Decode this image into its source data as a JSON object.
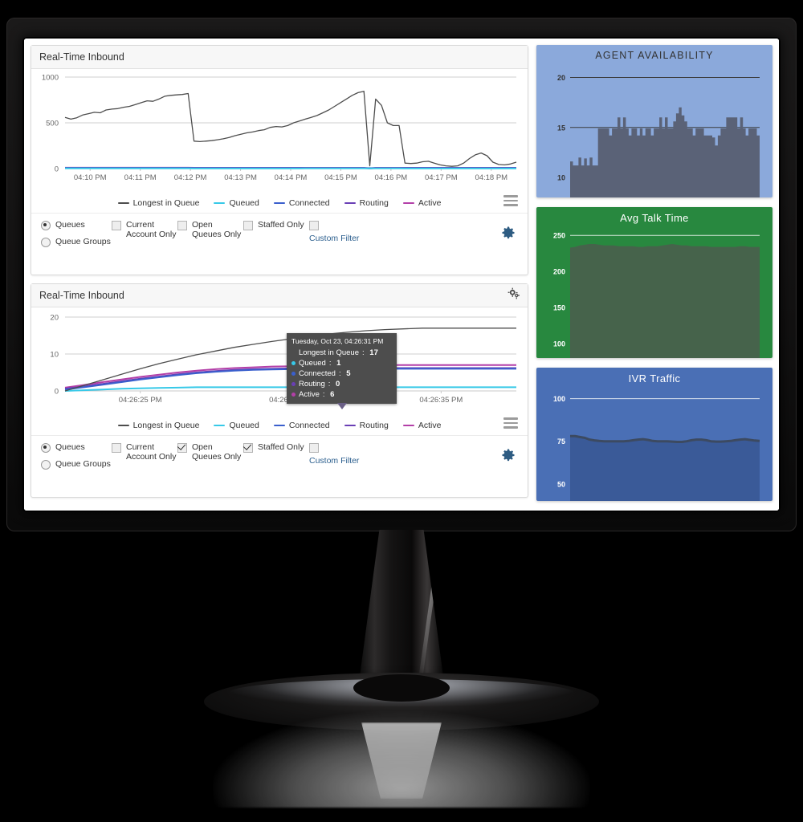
{
  "device": {
    "type": "desktop-monitor"
  },
  "panels": [
    {
      "title": "Real-Time Inbound",
      "header_icon": "hamburger-menu-icon",
      "legend": [
        {
          "label": "Longest in Queue",
          "color": "#4d4d4d"
        },
        {
          "label": "Queued",
          "color": "#37c9e8"
        },
        {
          "label": "Connected",
          "color": "#3a5fcd"
        },
        {
          "label": "Routing",
          "color": "#6a3fb5"
        },
        {
          "label": "Active",
          "color": "#b33fa8"
        }
      ],
      "controls": {
        "radios": [
          {
            "label": "Queues",
            "selected": true
          },
          {
            "label": "Queue Groups",
            "selected": false
          }
        ],
        "checkboxes": [
          {
            "label": "Current Account Only",
            "checked": false
          },
          {
            "label": "Open Queues Only",
            "checked": false
          },
          {
            "label": "Staffed Only",
            "checked": false
          }
        ],
        "custom_filter": {
          "label": "Custom Filter",
          "checked": false
        },
        "settings_icon": "gear-icon"
      }
    },
    {
      "title": "Real-Time Inbound",
      "header_icon": "settings-gears-icon",
      "legend": [
        {
          "label": "Longest in Queue",
          "color": "#4d4d4d"
        },
        {
          "label": "Queued",
          "color": "#37c9e8"
        },
        {
          "label": "Connected",
          "color": "#3a5fcd"
        },
        {
          "label": "Routing",
          "color": "#6a3fb5"
        },
        {
          "label": "Active",
          "color": "#b33fa8"
        }
      ],
      "controls": {
        "radios": [
          {
            "label": "Queues",
            "selected": true
          },
          {
            "label": "Queue Groups",
            "selected": false
          }
        ],
        "checkboxes": [
          {
            "label": "Current Account Only",
            "checked": false
          },
          {
            "label": "Open Queues Only",
            "checked": true
          },
          {
            "label": "Staffed Only",
            "checked": true
          }
        ],
        "custom_filter": {
          "label": "Custom Filter",
          "checked": false
        },
        "settings_icon": "gear-icon"
      }
    }
  ],
  "tooltip": {
    "timestamp": "Tuesday, Oct 23, 04:26:31 PM",
    "rows": [
      {
        "label": "Longest in Queue",
        "value": "17",
        "color": "#4d4d4d",
        "dot": false
      },
      {
        "label": "Queued",
        "value": "1",
        "color": "#37c9e8",
        "dot": true
      },
      {
        "label": "Connected",
        "value": "5",
        "color": "#3a5fcd",
        "dot": true
      },
      {
        "label": "Routing",
        "value": "0",
        "color": "#6a3fb5",
        "dot": true
      },
      {
        "label": "Active",
        "value": "6",
        "color": "#b33fa8",
        "dot": true
      }
    ]
  },
  "chart_data": [
    {
      "id": "realtime-inbound-top",
      "type": "line",
      "title": "Real-Time Inbound",
      "xlabel": "",
      "ylabel": "",
      "ylim": [
        0,
        1000
      ],
      "yticks": [
        0,
        500,
        1000
      ],
      "grid": true,
      "legend_position": "bottom",
      "xticks": [
        "04:10 PM",
        "04:11 PM",
        "04:12 PM",
        "04:13 PM",
        "04:14 PM",
        "04:15 PM",
        "04:16 PM",
        "04:17 PM",
        "04:18 PM"
      ],
      "series": [
        {
          "name": "Longest in Queue",
          "color": "#4d4d4d",
          "values": [
            560,
            540,
            555,
            585,
            600,
            615,
            610,
            640,
            650,
            655,
            670,
            680,
            700,
            720,
            740,
            735,
            760,
            790,
            800,
            805,
            810,
            820,
            300,
            295,
            300,
            305,
            315,
            325,
            340,
            360,
            375,
            390,
            400,
            415,
            425,
            450,
            460,
            455,
            470,
            500,
            520,
            540,
            560,
            580,
            610,
            640,
            680,
            720,
            760,
            800,
            830,
            845,
            30,
            760,
            690,
            500,
            470,
            470,
            60,
            55,
            60,
            75,
            80,
            60,
            40,
            30,
            25,
            30,
            60,
            110,
            150,
            170,
            140,
            70,
            45,
            40,
            50,
            70
          ]
        },
        {
          "name": "Queued",
          "color": "#37c9e8",
          "values": [
            2,
            2,
            2,
            3,
            2,
            2,
            2,
            2,
            2,
            2,
            2,
            2,
            2,
            2,
            2,
            2,
            2,
            2,
            2,
            2,
            2,
            2,
            1,
            1,
            1,
            1,
            1,
            1,
            1,
            1,
            1,
            1,
            1,
            1,
            1,
            1,
            1,
            1,
            1,
            1,
            1,
            2,
            2,
            2,
            2,
            2,
            2,
            2,
            2,
            2,
            2,
            2,
            1,
            2,
            2,
            2,
            2,
            2,
            1,
            1,
            1,
            1,
            1,
            1,
            1,
            1,
            1,
            1,
            1,
            1,
            1,
            1,
            1,
            1,
            1,
            1,
            1,
            1
          ]
        },
        {
          "name": "Connected",
          "color": "#3a5fcd",
          "values": [
            6,
            6,
            6,
            6,
            6,
            6,
            6,
            6,
            6,
            6,
            6,
            6,
            6,
            6,
            6,
            6,
            6,
            6,
            6,
            6,
            6,
            6,
            5,
            5,
            5,
            5,
            5,
            5,
            5,
            5,
            5,
            5,
            5,
            5,
            5,
            5,
            5,
            5,
            5,
            5,
            5,
            5,
            5,
            5,
            5,
            5,
            5,
            5,
            5,
            5,
            5,
            5,
            5,
            5,
            5,
            5,
            5,
            5,
            5,
            5,
            5,
            5,
            5,
            5,
            5,
            5,
            5,
            5,
            5,
            5,
            5,
            5,
            5,
            5,
            5,
            5,
            5,
            5
          ]
        },
        {
          "name": "Routing",
          "color": "#6a3fb5",
          "values": [
            8,
            8,
            8,
            8,
            8,
            8,
            8,
            8,
            8,
            8,
            8,
            8,
            8,
            8,
            8,
            8,
            8,
            8,
            8,
            8,
            8,
            8,
            7,
            7,
            7,
            7,
            7,
            7,
            7,
            7,
            7,
            7,
            7,
            7,
            7,
            7,
            7,
            7,
            7,
            7,
            7,
            7,
            7,
            7,
            7,
            7,
            7,
            7,
            7,
            7,
            7,
            7,
            0,
            7,
            7,
            7,
            7,
            7,
            7,
            7,
            7,
            7,
            7,
            7,
            7,
            7,
            7,
            7,
            7,
            7,
            7,
            7,
            7,
            7,
            7,
            7,
            7,
            7
          ]
        },
        {
          "name": "Active",
          "color": "#b33fa8",
          "values": [
            10,
            10,
            10,
            10,
            10,
            10,
            10,
            10,
            10,
            10,
            10,
            10,
            10,
            10,
            10,
            10,
            10,
            10,
            10,
            10,
            10,
            10,
            9,
            9,
            9,
            9,
            9,
            9,
            9,
            9,
            9,
            9,
            9,
            9,
            9,
            9,
            9,
            9,
            9,
            9,
            9,
            9,
            9,
            9,
            9,
            9,
            9,
            9,
            9,
            9,
            9,
            9,
            2,
            9,
            9,
            9,
            9,
            9,
            9,
            9,
            9,
            9,
            9,
            9,
            9,
            9,
            9,
            9,
            9,
            9,
            9,
            9,
            9,
            9,
            9,
            9,
            9,
            9
          ]
        }
      ]
    },
    {
      "id": "realtime-inbound-bottom",
      "type": "line",
      "title": "Real-Time Inbound",
      "xlabel": "",
      "ylabel": "",
      "ylim": [
        0,
        20
      ],
      "yticks": [
        0,
        10,
        20
      ],
      "grid": true,
      "legend_position": "bottom",
      "xticks": [
        "04:26:25 PM",
        "04:26:30 PM",
        "04:26:35 PM"
      ],
      "series": [
        {
          "name": "Longest in Queue",
          "color": "#4d4d4d",
          "values": [
            0,
            1.5,
            3,
            4.5,
            6,
            7.4,
            8.6,
            9.8,
            10.8,
            11.8,
            12.6,
            13.4,
            14.1,
            14.8,
            15.4,
            15.9,
            16.3,
            16.6,
            16.8,
            17,
            17,
            17,
            17,
            17,
            17
          ]
        },
        {
          "name": "Queued",
          "color": "#37c9e8",
          "values": [
            0,
            0.2,
            0.4,
            0.6,
            0.7,
            0.8,
            0.9,
            1,
            1,
            1,
            1,
            1,
            1,
            1,
            1,
            1,
            1,
            1,
            1,
            1,
            1,
            1,
            1,
            1,
            1
          ]
        },
        {
          "name": "Connected",
          "color": "#3a5fcd",
          "values": [
            0.4,
            1,
            1.7,
            2.4,
            3.1,
            3.7,
            4.3,
            4.8,
            5.2,
            5.5,
            5.7,
            5.8,
            5.9,
            6,
            6,
            6,
            6,
            6,
            6,
            6,
            6,
            6,
            6,
            6,
            6
          ]
        },
        {
          "name": "Routing",
          "color": "#6a3fb5",
          "values": [
            0.6,
            1.2,
            1.9,
            2.6,
            3.3,
            3.9,
            4.5,
            5,
            5.4,
            5.7,
            5.9,
            6,
            6.1,
            6.2,
            6.2,
            6.2,
            6.2,
            6.2,
            6.2,
            6.2,
            6.2,
            6.2,
            6.2,
            6.2,
            6.2
          ]
        },
        {
          "name": "Active",
          "color": "#b33fa8",
          "values": [
            0.9,
            1.6,
            2.4,
            3.1,
            3.8,
            4.4,
            5,
            5.5,
            5.9,
            6.2,
            6.4,
            6.6,
            6.7,
            6.8,
            6.9,
            7,
            7,
            7,
            7,
            7,
            7,
            7,
            7,
            7,
            7
          ]
        }
      ]
    },
    {
      "id": "agent-availability",
      "type": "area",
      "title": "AGENT AVAILABILITY",
      "bg_color": "#8ba9db",
      "area_color": "#5a6277",
      "ylim": [
        8,
        21
      ],
      "yticks": [
        10,
        15,
        20
      ],
      "grid": true,
      "values": [
        11.6,
        11.2,
        11.2,
        12,
        11.2,
        11.9,
        11.2,
        12,
        11.2,
        11.2,
        14.9,
        14.9,
        14.9,
        14.9,
        14.2,
        14.9,
        14.9,
        16,
        14.9,
        16,
        14.9,
        14.2,
        14.9,
        14.9,
        14.2,
        14.9,
        14.2,
        14.9,
        14.9,
        14.2,
        14.9,
        14.9,
        16,
        14.9,
        16,
        14.9,
        14.9,
        15.6,
        16.4,
        17,
        16.2,
        15.6,
        14.9,
        14.9,
        14.2,
        14.9,
        14.9,
        14.9,
        14.2,
        14.2,
        14.2,
        14,
        13.2,
        14.2,
        14.9,
        14.9,
        16,
        16,
        16,
        16,
        14.9,
        16,
        14.9,
        14.2,
        14.9,
        14.9,
        14.9,
        14.2,
        14.2
      ]
    },
    {
      "type": "area",
      "id": "avg-talk-time",
      "title": "Avg Talk Time",
      "bg_color": "#28883f",
      "area_color": "#46634b",
      "ylim": [
        80,
        258
      ],
      "yticks": [
        100,
        150,
        200,
        250
      ],
      "grid": true,
      "values": [
        233,
        234,
        236,
        237,
        238,
        238,
        237,
        236,
        236,
        236,
        235,
        235,
        235,
        235,
        234,
        234,
        235,
        235,
        235,
        236,
        237,
        238,
        237,
        236,
        236,
        235,
        235,
        235,
        235,
        234,
        234,
        234,
        234,
        234,
        234,
        235,
        235,
        234,
        234,
        234
      ]
    },
    {
      "id": "ivr-traffic",
      "type": "area",
      "title": "IVR Traffic",
      "bg_color": "#4a6fb5",
      "area_color": "#3a5a98",
      "line_color": "#3c4a61",
      "ylim": [
        40,
        105
      ],
      "yticks": [
        50,
        75,
        100
      ],
      "grid": true,
      "values": [
        78,
        78,
        77.5,
        77,
        76,
        75.5,
        75.2,
        75,
        75,
        75,
        75,
        75,
        75.2,
        75.6,
        76,
        76.2,
        75.8,
        75.2,
        75,
        75,
        75,
        74.8,
        74.6,
        74.6,
        75,
        75.6,
        76,
        76,
        75.6,
        75,
        74.8,
        74.8,
        75,
        75.2,
        75.6,
        76,
        76.2,
        75.8,
        75.4,
        75.2
      ]
    }
  ]
}
